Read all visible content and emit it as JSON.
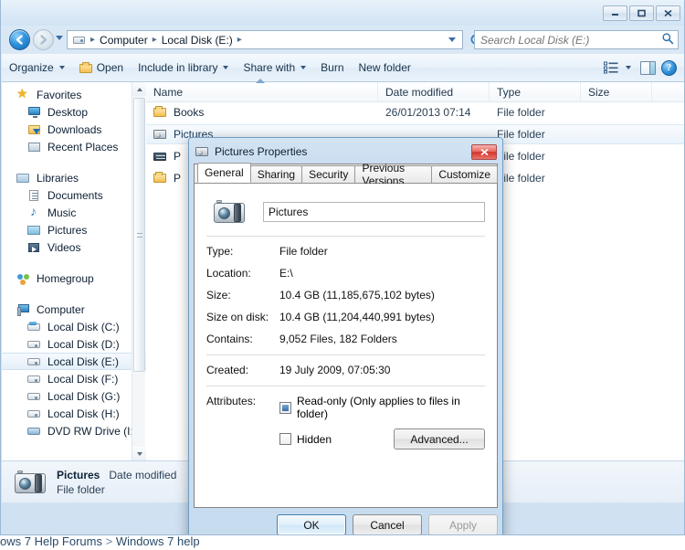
{
  "window": {
    "title": "",
    "controls": {
      "minimize": "Minimize",
      "maximize": "Maximize",
      "close": "Close"
    }
  },
  "address": {
    "back_tooltip": "Back",
    "forward_tooltip": "Forward",
    "crumbs": [
      "Computer",
      "Local Disk (E:)"
    ],
    "separator": "▸",
    "refresh": "↻"
  },
  "search": {
    "placeholder": "Search Local Disk (E:)",
    "value": "",
    "icon": "search-icon"
  },
  "toolbar": {
    "organize": "Organize",
    "open": "Open",
    "include_in_library": "Include in library",
    "share_with": "Share with",
    "burn": "Burn",
    "new_folder": "New folder",
    "help": "?"
  },
  "sidebar": {
    "groups": [
      {
        "header": {
          "label": "Favorites",
          "icon": "star-icon"
        },
        "items": [
          {
            "label": "Desktop",
            "icon": "desktop-icon"
          },
          {
            "label": "Downloads",
            "icon": "downloads-icon"
          },
          {
            "label": "Recent Places",
            "icon": "recent-places-icon"
          }
        ]
      },
      {
        "header": {
          "label": "Libraries",
          "icon": "libraries-icon"
        },
        "items": [
          {
            "label": "Documents",
            "icon": "documents-icon"
          },
          {
            "label": "Music",
            "icon": "music-icon"
          },
          {
            "label": "Pictures",
            "icon": "pictures-icon"
          },
          {
            "label": "Videos",
            "icon": "videos-icon"
          }
        ]
      },
      {
        "header": {
          "label": "Homegroup",
          "icon": "homegroup-icon"
        },
        "items": []
      },
      {
        "header": {
          "label": "Computer",
          "icon": "computer-icon"
        },
        "items": [
          {
            "label": "Local Disk (C:)",
            "icon": "system-disk-icon",
            "selected": false
          },
          {
            "label": "Local Disk (D:)",
            "icon": "disk-icon",
            "selected": false
          },
          {
            "label": "Local Disk (E:)",
            "icon": "disk-icon",
            "selected": true
          },
          {
            "label": "Local Disk (F:)",
            "icon": "disk-icon",
            "selected": false
          },
          {
            "label": "Local Disk (G:)",
            "icon": "disk-icon",
            "selected": false
          },
          {
            "label": "Local Disk (H:)",
            "icon": "disk-icon",
            "selected": false
          },
          {
            "label": "DVD RW Drive (I:)",
            "icon": "dvd-drive-icon",
            "selected": false
          }
        ]
      }
    ]
  },
  "filelist": {
    "columns": [
      "Name",
      "Date modified",
      "Type",
      "Size"
    ],
    "rows": [
      {
        "name": "Books",
        "date": "26/01/2013 07:14",
        "type": "File folder",
        "size": "",
        "icon": "folder-icon",
        "selected": false
      },
      {
        "name": "Pictures",
        "date": "",
        "type": "File folder",
        "size": "",
        "icon": "camera-icon",
        "selected": true
      },
      {
        "name": "P",
        "date": "",
        "type": "File folder",
        "size": "",
        "icon": "keyboard-icon",
        "selected": false
      },
      {
        "name": "P",
        "date": "",
        "type": "File folder",
        "size": "",
        "icon": "folder-icon",
        "selected": false
      }
    ]
  },
  "details": {
    "title": "Pictures",
    "date_label": "Date modified",
    "subtitle": "File folder",
    "icon": "camera-folder-icon"
  },
  "dialog": {
    "title": "Pictures Properties",
    "icon": "camera-folder-icon",
    "close_label": "✕",
    "tabs": [
      {
        "label": "General",
        "active": true
      },
      {
        "label": "Sharing",
        "active": false
      },
      {
        "label": "Security",
        "active": false
      },
      {
        "label": "Previous Versions",
        "active": false
      },
      {
        "label": "Customize",
        "active": false
      }
    ],
    "name_value": "Pictures",
    "properties": [
      {
        "label": "Type:",
        "value": "File folder"
      },
      {
        "label": "Location:",
        "value": "E:\\"
      },
      {
        "label": "Size:",
        "value": "10.4 GB (11,185,675,102 bytes)"
      },
      {
        "label": "Size on disk:",
        "value": "10.4 GB (11,204,440,991 bytes)"
      },
      {
        "label": "Contains:",
        "value": "9,052 Files, 182 Folders"
      }
    ],
    "created": {
      "label": "Created:",
      "value": "19 July 2009, 07:05:30"
    },
    "attributes": {
      "label": "Attributes:",
      "readonly_label": "Read-only (Only applies to files in folder)",
      "readonly_state": "indeterminate",
      "hidden_label": "Hidden",
      "hidden_state": "unchecked",
      "advanced_label": "Advanced..."
    },
    "buttons": {
      "ok": "OK",
      "cancel": "Cancel",
      "apply": "Apply",
      "apply_disabled": true
    }
  },
  "page_behind": {
    "text_a": "ows 7 Help Forums",
    "sep": " > ",
    "text_b": "Windows 7 help"
  }
}
